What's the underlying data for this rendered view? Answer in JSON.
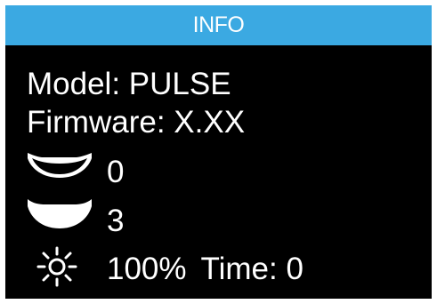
{
  "header": {
    "title": "INFO"
  },
  "info": {
    "model_label": "Model:",
    "model_value": "PULSE",
    "firmware_label": "Firmware:",
    "firmware_value": "X.XX",
    "cup_empty_count": "0",
    "cup_full_count": "3",
    "brightness_value": "100%",
    "time_label": "Time:",
    "time_value": "0"
  },
  "icons": {
    "cup_empty": "empty-cup-icon",
    "cup_full": "full-cup-icon",
    "brightness": "sun-brightness-icon"
  },
  "colors": {
    "title_bar": "#3ba9e2",
    "screen_background": "#000000",
    "text": "#ffffff"
  }
}
